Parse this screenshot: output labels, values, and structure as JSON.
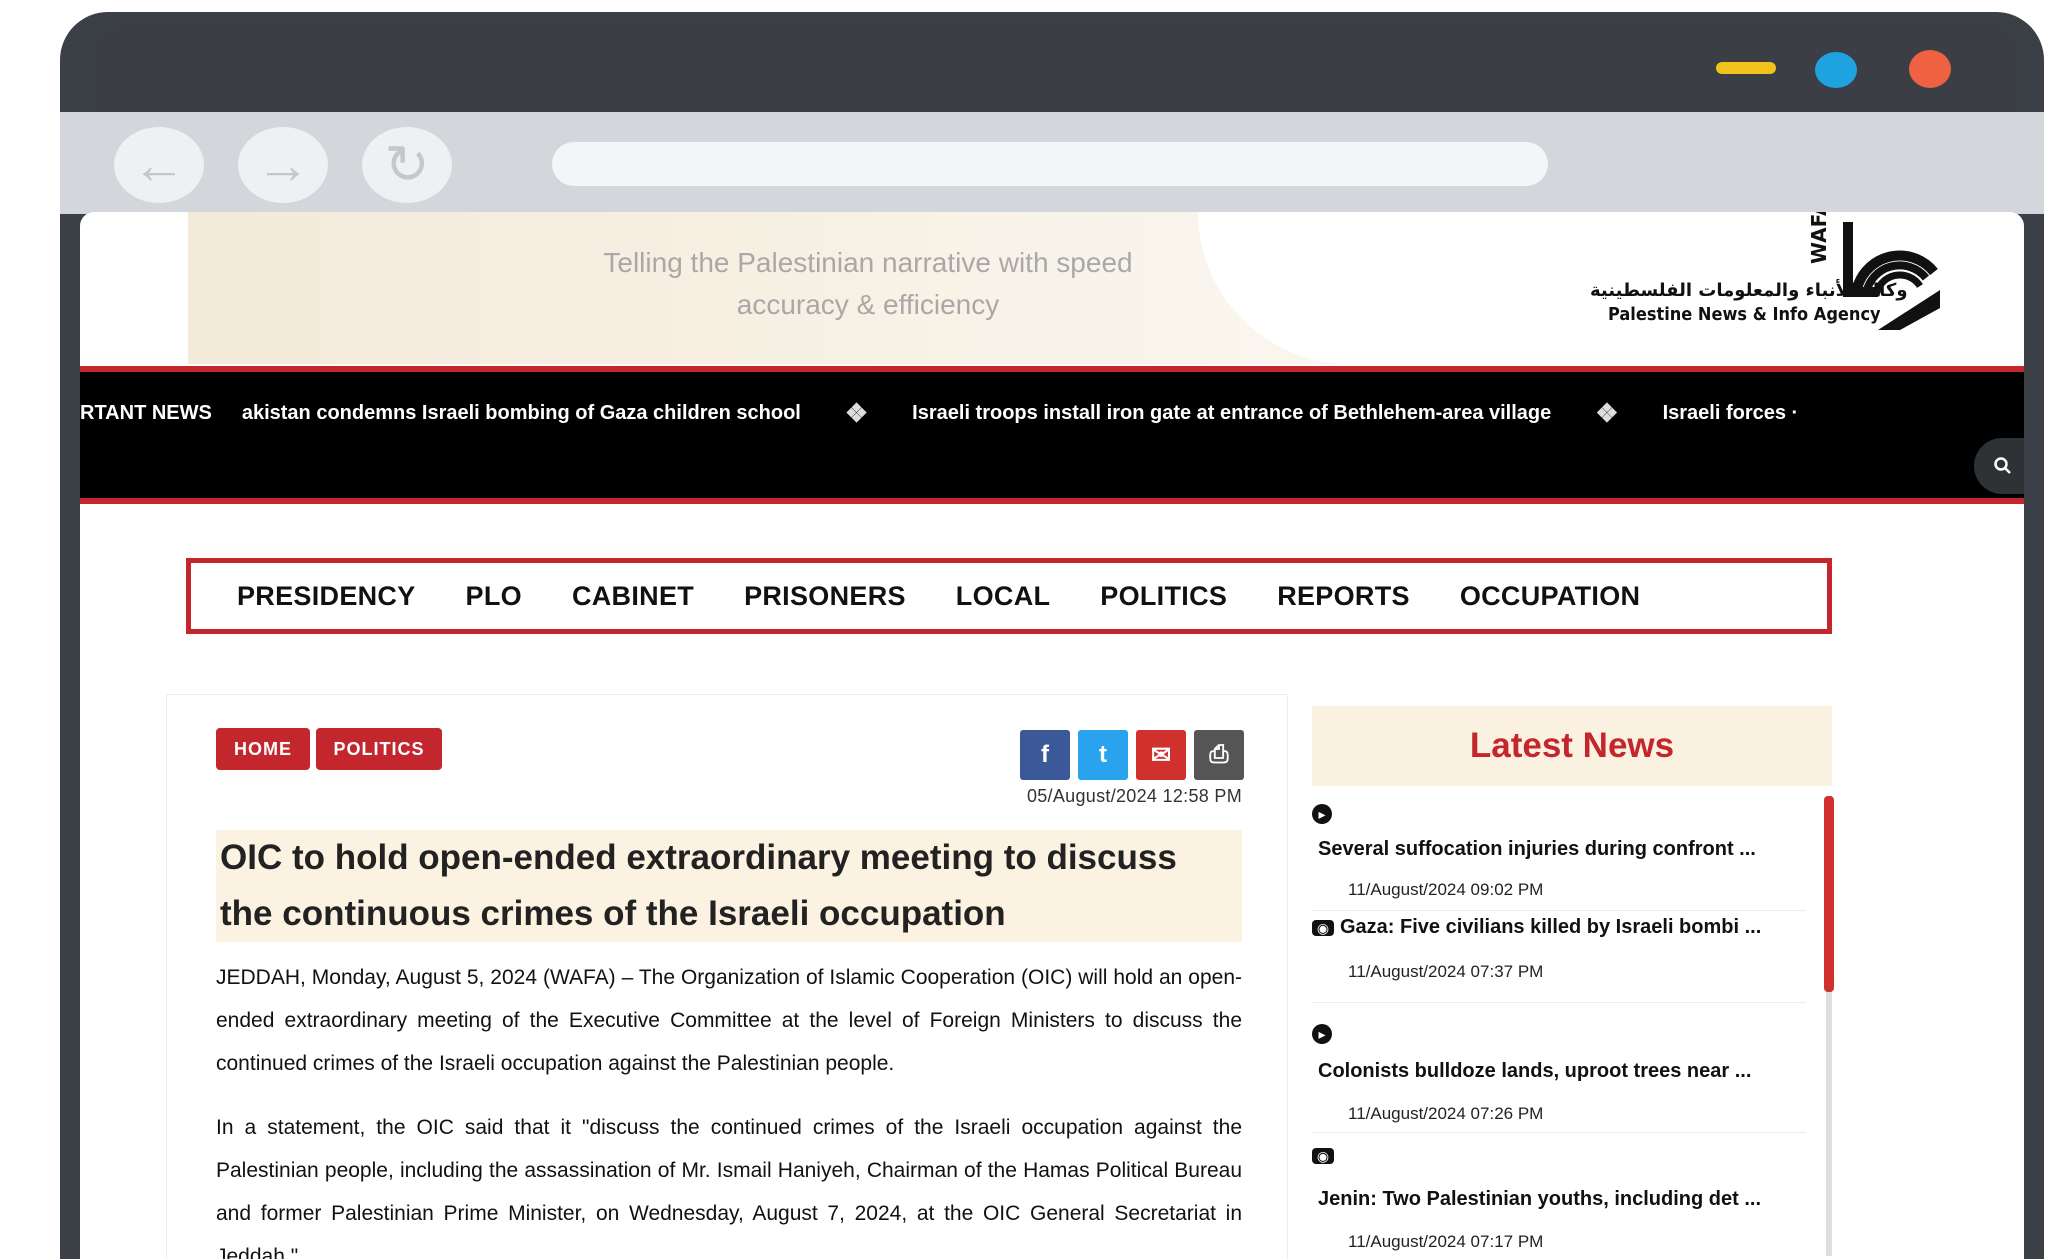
{
  "page": {
    "banner_tagline": [
      "Telling the Palestinian narrative with speed",
      "accuracy & efficiency"
    ],
    "logo_text_ar": "وكالة الأنباء والمعلومات الفلسطينية",
    "logo_text_en": "Palestine News & Info Agency",
    "logo_mark": "WAFA"
  },
  "ticker": {
    "label": "RTANT NEWS",
    "items": [
      "akistan condemns Israeli bombing of Gaza children school",
      "Israeli troops install iron gate at entrance of Bethlehem-area village",
      "Israeli forces ·"
    ]
  },
  "nav": {
    "items": [
      "PRESIDENCY",
      "PLO",
      "CABINET",
      "PRISONERS",
      "LOCAL",
      "POLITICS",
      "REPORTS",
      "OCCUPATION"
    ]
  },
  "breadcrumb": {
    "home": "HOME",
    "section": "POLITICS"
  },
  "share": {
    "facebook": "f",
    "twitter": "t",
    "email": "✉",
    "print": "⎙"
  },
  "article": {
    "date": "05/August/2024 12:58 PM",
    "headline": "OIC to hold open-ended extraordinary meeting to discuss the continuous crimes of the Israeli occupation",
    "para1": "JEDDAH, Monday, August 5, 2024 (WAFA) – The Organization of Islamic Cooperation (OIC) will hold an open-ended extraordinary meeting of the Executive Committee at the level of Foreign Ministers to discuss the continued crimes of the Israeli occupation against the Palestinian people.",
    "para2": "In a statement, the OIC said that it \"discuss the continued crimes of the Israeli occupation against the Palestinian people, including the assassination of Mr. Ismail Haniyeh, Chairman of the Hamas Political Bureau and former Palestinian Prime Minister, on Wednesday, August 7, 2024, at the OIC General Secretariat in Jeddah.\""
  },
  "latest": {
    "title": "Latest News",
    "items": [
      {
        "icon": "play-icon",
        "title": "Several suffocation injuries during confront ...",
        "date": "11/August/2024 09:02 PM"
      },
      {
        "icon": "camera-icon",
        "title": "Gaza: Five civilians killed by Israeli bombi ...",
        "date": "11/August/2024 07:37 PM"
      },
      {
        "icon": "play-icon",
        "title": "Colonists bulldoze lands, uproot trees near ...",
        "date": "11/August/2024 07:26 PM"
      },
      {
        "icon": "camera-icon",
        "title": "Jenin: Two Palestinian youths, including det ...",
        "date": "11/August/2024 07:17 PM"
      }
    ]
  },
  "colors": {
    "accent_red": "#c4262e",
    "frame_dark": "#3b4046",
    "window_min": "#f0c21b",
    "window_max": "#1fa2e0",
    "window_close": "#ee6242"
  }
}
